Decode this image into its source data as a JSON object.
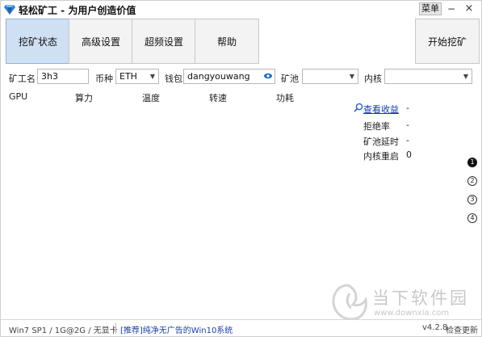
{
  "window": {
    "title": "轻松矿工 - 为用户创造价值",
    "menu_label": "菜单",
    "minimize": "−",
    "close": "×"
  },
  "tabs": [
    {
      "label": "挖矿状态",
      "active": true
    },
    {
      "label": "高级设置",
      "active": false
    },
    {
      "label": "超频设置",
      "active": false
    },
    {
      "label": "帮助",
      "active": false
    }
  ],
  "start_button": "开始挖矿",
  "config": {
    "worker_label": "矿工名",
    "worker_value": "3h3",
    "coin_label": "币种",
    "coin_value": "ETH",
    "wallet_label": "钱包",
    "wallet_value": "dangyouwang",
    "pool_label": "矿池",
    "pool_value": "",
    "kernel_label": "内核",
    "kernel_value": ""
  },
  "table": {
    "columns": [
      "GPU",
      "算力",
      "温度",
      "转速",
      "功耗"
    ]
  },
  "stats": [
    {
      "label": "查看收益",
      "value": "-",
      "link": true
    },
    {
      "label": "拒绝率",
      "value": "-",
      "link": false
    },
    {
      "label": "矿池延时",
      "value": "-",
      "link": false
    },
    {
      "label": "内核重启",
      "value": "0",
      "link": false
    }
  ],
  "gpu_pages": [
    "1",
    "2",
    "3",
    "4"
  ],
  "active_page": 1,
  "statusbar": {
    "sys_info": "Win7 SP1 / 1G@2G / 无显卡",
    "promo": "[推荐]纯净无广告的Win10系统",
    "version": "v4.2.8",
    "update": "检查更新"
  },
  "watermark": {
    "text": "当下软件园",
    "url": "www.downxia.com"
  },
  "colors": {
    "active_tab": "#cfe0f3",
    "link": "#0b3ea8",
    "gem": "#2e7fd6"
  }
}
